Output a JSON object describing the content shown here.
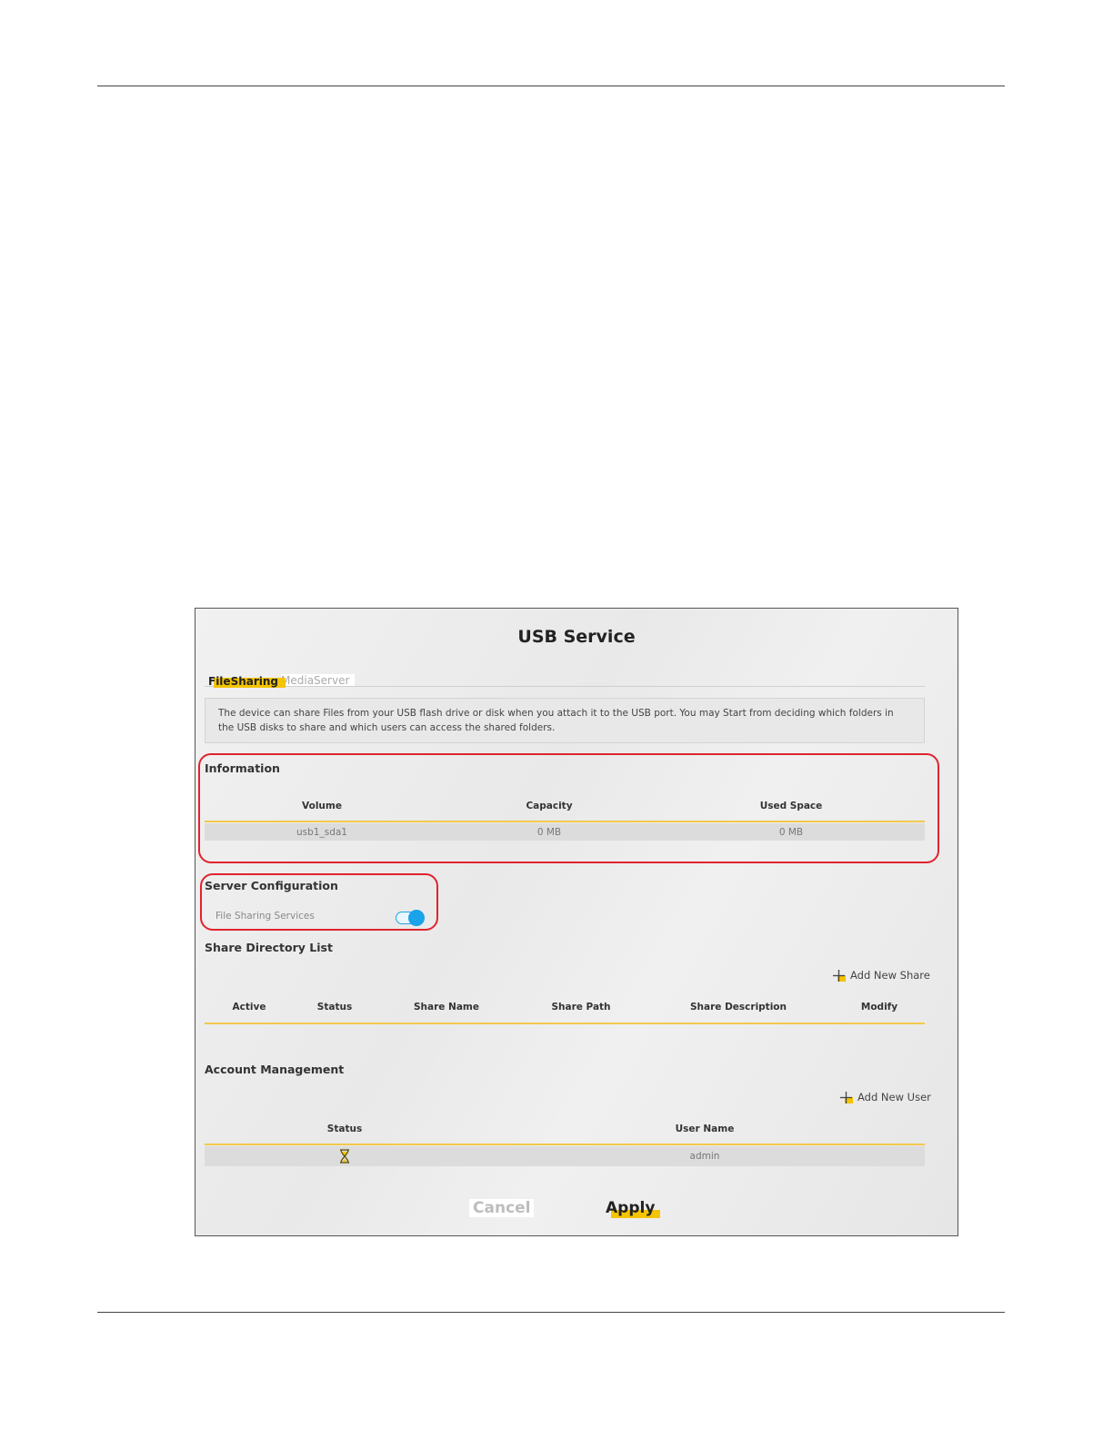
{
  "page": {
    "title": "USB Service",
    "tabs": [
      "FileSharing",
      "MediaServer"
    ],
    "description": "The device can share Files from your USB flash drive or disk when you attach it to the USB port. You may Start from deciding which folders in the USB disks to share and which users can access the shared folders."
  },
  "information": {
    "heading": "Information",
    "columns": [
      "Volume",
      "Capacity",
      "Used Space"
    ],
    "row": [
      "usb1_sda1",
      "0 MB",
      "0 MB"
    ]
  },
  "server_config": {
    "heading": "Server Configuration",
    "label": "File Sharing Services",
    "enabled": true
  },
  "share_directory": {
    "heading": "Share Directory List",
    "add_label": "Add New Share",
    "columns": [
      "Active",
      "Status",
      "Share Name",
      "Share Path",
      "Share Description",
      "Modify"
    ]
  },
  "accounts": {
    "heading": "Account Management",
    "add_label": "Add New User",
    "columns": [
      "Status",
      "User Name"
    ],
    "row": {
      "status_icon": "hourglass-icon",
      "user_name": "admin"
    }
  },
  "buttons": {
    "cancel": "Cancel",
    "apply": "Apply"
  },
  "colors": {
    "accent": "#f4c400",
    "highlight_box": "#e0242e",
    "toggle": "#1aa3e8"
  }
}
